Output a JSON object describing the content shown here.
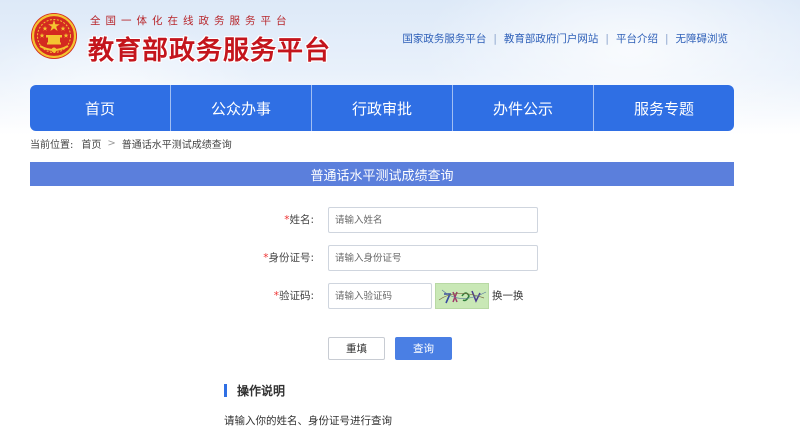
{
  "header": {
    "logo_subtitle": "全国一体化在线政务服务平台",
    "logo_title": "教育部政务服务平台",
    "top_links": [
      "国家政务服务平台",
      "教育部政府门户网站",
      "平台介绍",
      "无障碍浏览"
    ]
  },
  "nav": {
    "items": [
      {
        "label": "首页"
      },
      {
        "label": "公众办事"
      },
      {
        "label": "行政审批"
      },
      {
        "label": "办件公示"
      },
      {
        "label": "服务专题"
      }
    ]
  },
  "breadcrumb": {
    "prefix": "当前位置:",
    "home": "首页",
    "separator": ">",
    "current": "普通话水平测试成绩查询"
  },
  "page": {
    "title": "普通话水平测试成绩查询"
  },
  "form": {
    "required_mark": "*",
    "name": {
      "label": "姓名:",
      "placeholder": "请输入姓名",
      "value": ""
    },
    "id_number": {
      "label": "身份证号:",
      "placeholder": "请输入身份证号",
      "value": ""
    },
    "captcha": {
      "label": "验证码:",
      "placeholder": "请输入验证码",
      "value": "",
      "refresh_label": "换一换"
    }
  },
  "buttons": {
    "reset_label": "重填",
    "query_label": "查询"
  },
  "instructions": {
    "title": "操作说明",
    "text": "请输入你的姓名、身份证号进行查询"
  },
  "colors": {
    "nav_bg": "#2f6fe4",
    "title_bar_bg": "#5b7fdc",
    "logo_red": "#c4151c",
    "link_blue": "#2d5fb8",
    "query_button_bg": "#4a7fe4",
    "captcha_bg": "#c9e8b6",
    "required_red": "#ee3333"
  },
  "icons": {
    "emblem": "national-emblem-icon"
  }
}
